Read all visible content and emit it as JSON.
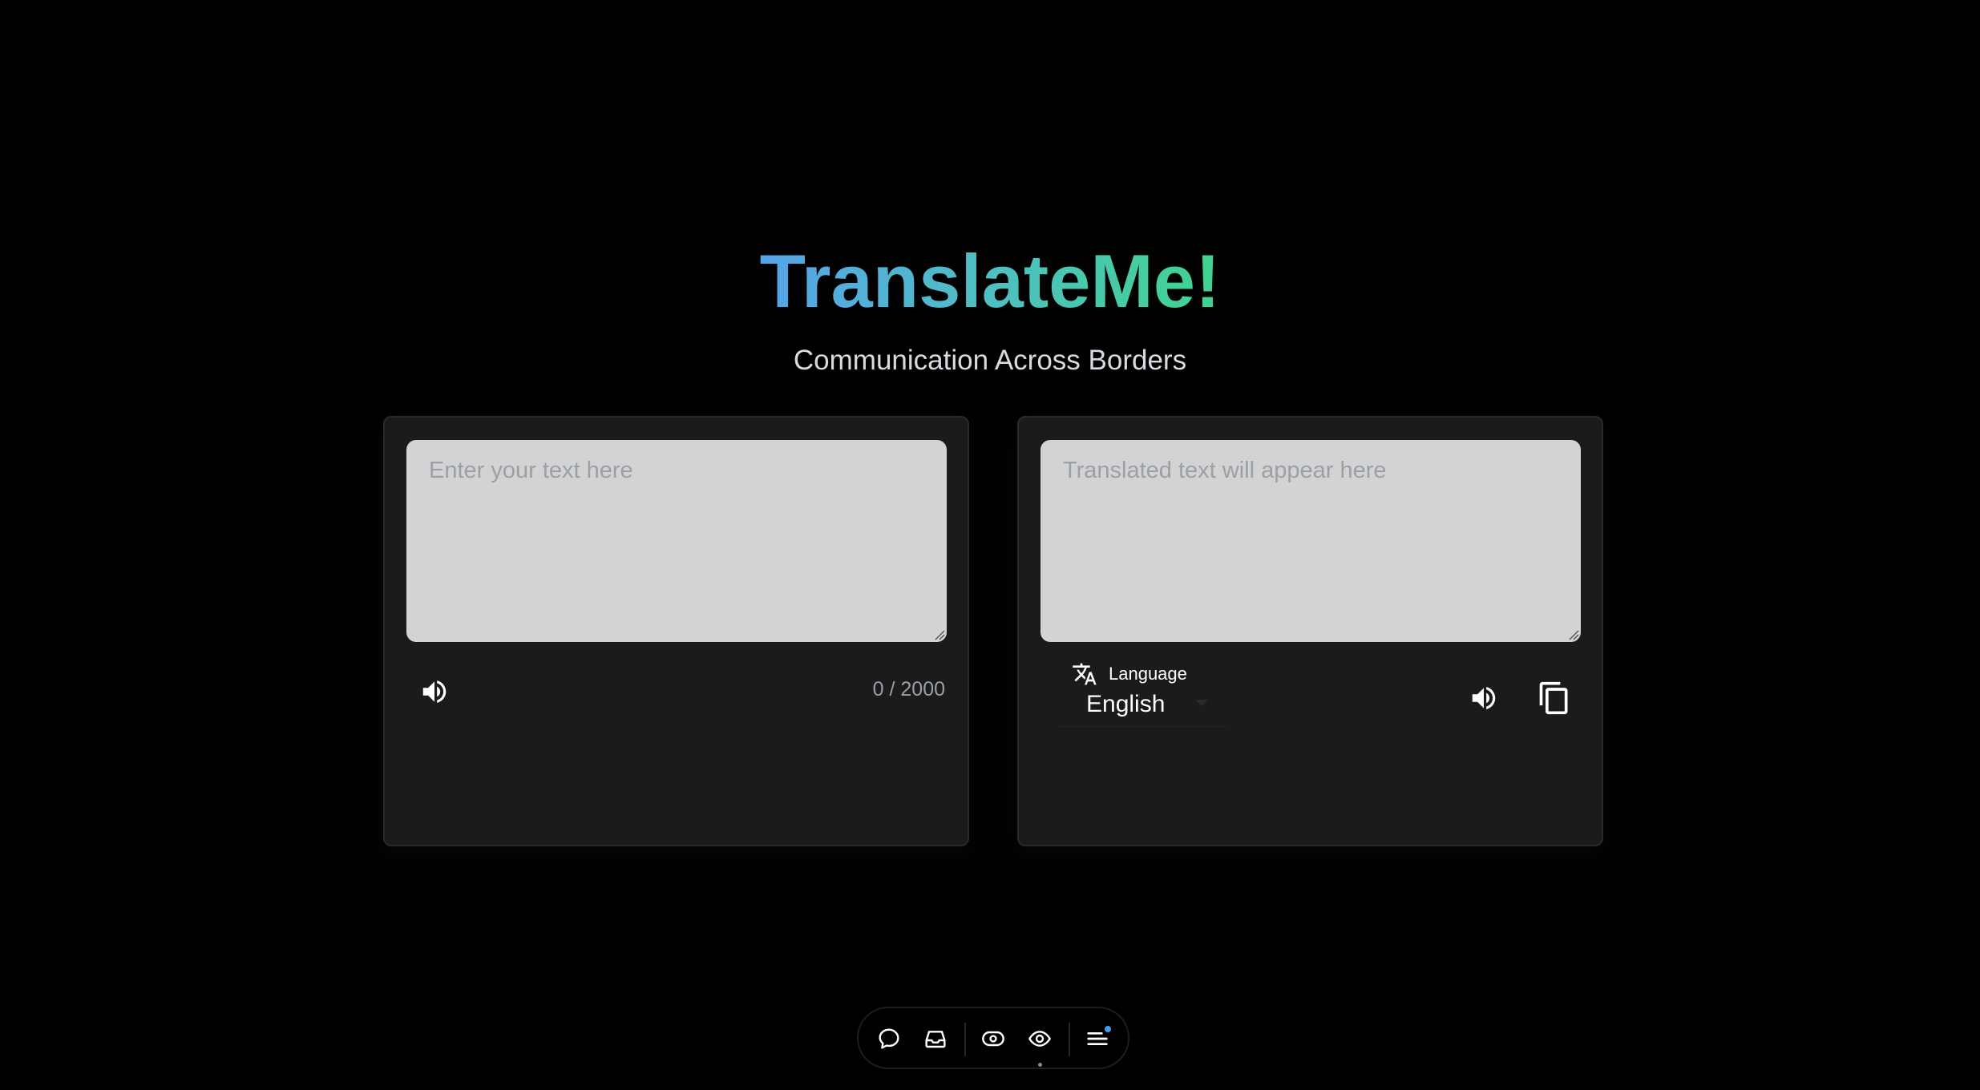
{
  "app": {
    "title": "TranslateMe!",
    "subtitle": "Communication Across Borders"
  },
  "source": {
    "placeholder": "Enter your text here",
    "value": "",
    "counter": "0 / 2000",
    "speak_icon": "volume-icon"
  },
  "target": {
    "placeholder": "Translated text will appear here",
    "value": "",
    "language_label": "Language",
    "language_icon": "translate-icon",
    "language_value": "English",
    "speak_icon": "volume-icon",
    "copy_icon": "copy-icon"
  },
  "dock": {
    "items": [
      {
        "icon": "chat-bubble-icon"
      },
      {
        "icon": "inbox-icon"
      },
      {
        "icon": "eye-outline-icon"
      },
      {
        "icon": "eye-icon"
      },
      {
        "icon": "menu-icon"
      }
    ]
  },
  "colors": {
    "background": "#000000",
    "card": "#1b1b1b",
    "textarea": "#d3d3d3",
    "title_gradient_start": "#56a3e8",
    "title_gradient_end": "#3fd48e",
    "notification_dot": "#4a9be8"
  }
}
